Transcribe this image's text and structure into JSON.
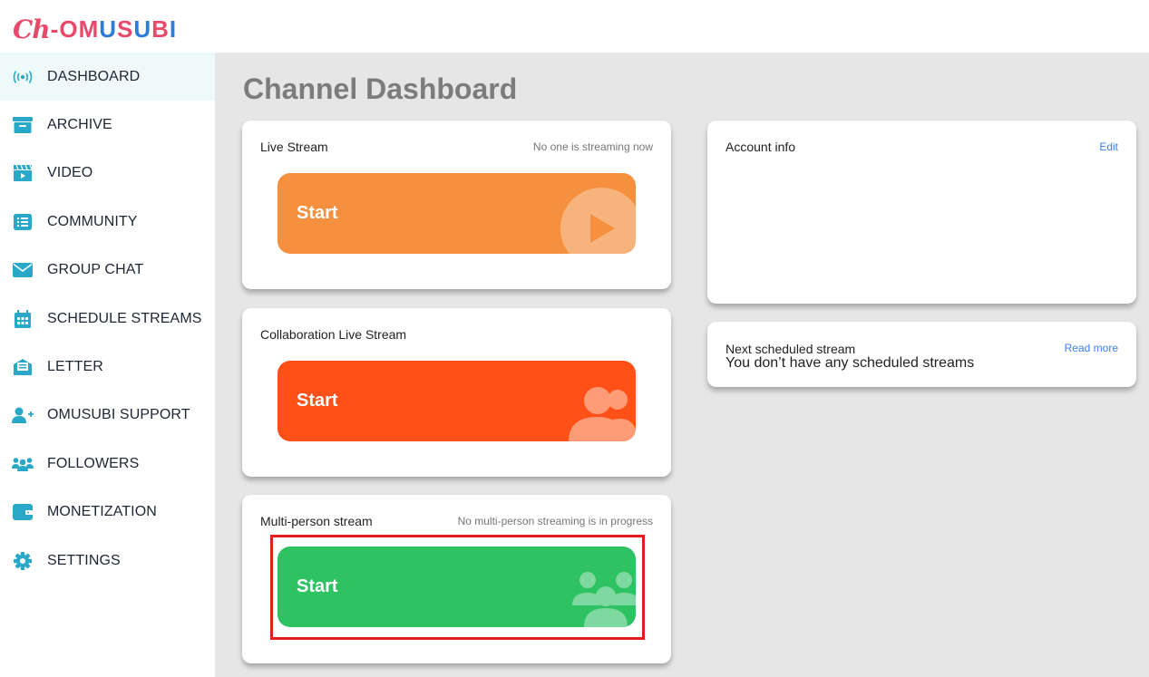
{
  "logo": {
    "ch": "Ch",
    "dash": "-",
    "o1": "O",
    "m": "M",
    "u1": "U",
    "s": "S",
    "u2": "U",
    "b": "B",
    "i": "I"
  },
  "sidebar": {
    "items": [
      {
        "label": "DASHBOARD",
        "icon": "broadcast-icon"
      },
      {
        "label": "ARCHIVE",
        "icon": "archive-box-icon"
      },
      {
        "label": "VIDEO",
        "icon": "clapperboard-icon"
      },
      {
        "label": "COMMUNITY",
        "icon": "list-icon"
      },
      {
        "label": "GROUP CHAT",
        "icon": "envelope-icon"
      },
      {
        "label": "SCHEDULE STREAMS",
        "icon": "calendar-icon"
      },
      {
        "label": "LETTER",
        "icon": "letter-icon"
      },
      {
        "label": "OMUSUBI SUPPORT",
        "icon": "add-user-icon"
      },
      {
        "label": "FOLLOWERS",
        "icon": "followers-icon"
      },
      {
        "label": "MONETIZATION",
        "icon": "wallet-icon"
      },
      {
        "label": "SETTINGS",
        "icon": "gear-icon"
      }
    ]
  },
  "main": {
    "title": "Channel Dashboard",
    "live_stream": {
      "title": "Live Stream",
      "status": "No one is streaming now",
      "button": "Start"
    },
    "collab_stream": {
      "title": "Collaboration Live Stream",
      "button": "Start"
    },
    "multi_stream": {
      "title": "Multi-person stream",
      "status": "No multi-person streaming is in progress",
      "button": "Start"
    },
    "account_info": {
      "title": "Account info",
      "link": "Edit"
    },
    "next_scheduled": {
      "title": "Next scheduled stream",
      "link": "Read more",
      "message": "You don’t have any scheduled streams"
    }
  },
  "colors": {
    "live_button": "#f5913e",
    "collab_button": "#ff5018",
    "multi_button": "#2fc263",
    "highlight": "#e51c1c",
    "sidebar_icon": "#29a9c7"
  }
}
